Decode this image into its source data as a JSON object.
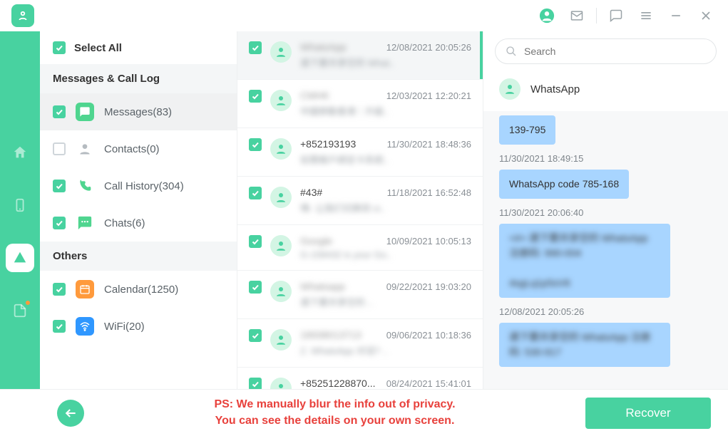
{
  "header": {
    "select_all": "Select All",
    "search_placeholder": "Search"
  },
  "sections": {
    "msg_log": "Messages & Call Log",
    "others": "Others"
  },
  "categories": {
    "messages": "Messages(83)",
    "contacts": "Contacts(0)",
    "call_history": "Call History(304)",
    "chats": "Chats(6)",
    "calendar": "Calendar(1250)",
    "wifi": "WiFi(20)"
  },
  "msgs": [
    {
      "title": "WhatsApp",
      "prev": "適下要共享空的 What..",
      "date": "12/08/2021 20:05:26",
      "blurTitle": true,
      "blurPrev": true
    },
    {
      "title": "CMHK",
      "prev": "中國移動香港｜升級..",
      "date": "12/03/2021 12:20:21",
      "blurTitle": true,
      "blurPrev": true
    },
    {
      "title": "+852193193",
      "prev": "如需帳戶綁定卡系統..",
      "date": "11/30/2021 18:48:36",
      "blurTitle": false,
      "blurPrev": true
    },
    {
      "title": "#43#",
      "prev": "咦-  让我们切换到 vi..",
      "date": "11/18/2021 16:52:48",
      "blurTitle": false,
      "blurPrev": true
    },
    {
      "title": "Google",
      "prev": "G-158432 is your Go..",
      "date": "10/09/2021 10:05:13",
      "blurTitle": true,
      "blurPrev": true
    },
    {
      "title": "Whatsapp",
      "prev": "適下要共享空的 ..",
      "date": "09/22/2021 19:03:20",
      "blurTitle": true,
      "blurPrev": true
    },
    {
      "title": "18938013713",
      "prev": "Z. WhatsApp 对话? ..",
      "date": "09/06/2021 10:18:36",
      "blurTitle": true,
      "blurPrev": true
    },
    {
      "title": "+85251228870...",
      "prev": "",
      "date": "08/24/2021 15:41:01",
      "blurTitle": false,
      "blurPrev": false
    }
  ],
  "detail": {
    "name": "WhatsApp",
    "chats": [
      {
        "ts": "",
        "text": "139-795",
        "blur": false
      },
      {
        "ts": "11/30/2021 18:49:15",
        "text": "WhatsApp code 785-168",
        "blur": false
      },
      {
        "ts": "11/30/2021 20:06:40",
        "text": "<#> 適下要共享空的 WhatsApp 注册码: 990-004\n\n4sgLq1p5sV6",
        "blur": true
      },
      {
        "ts": "12/08/2021 20:05:26",
        "text": "適下要共享空的 WhatsApp 注册码: 530-917",
        "blur": true
      }
    ]
  },
  "footer": {
    "note1": "PS: We manually blur the info out of privacy.",
    "note2": "You can see the details on your own screen.",
    "recover": "Recover"
  }
}
